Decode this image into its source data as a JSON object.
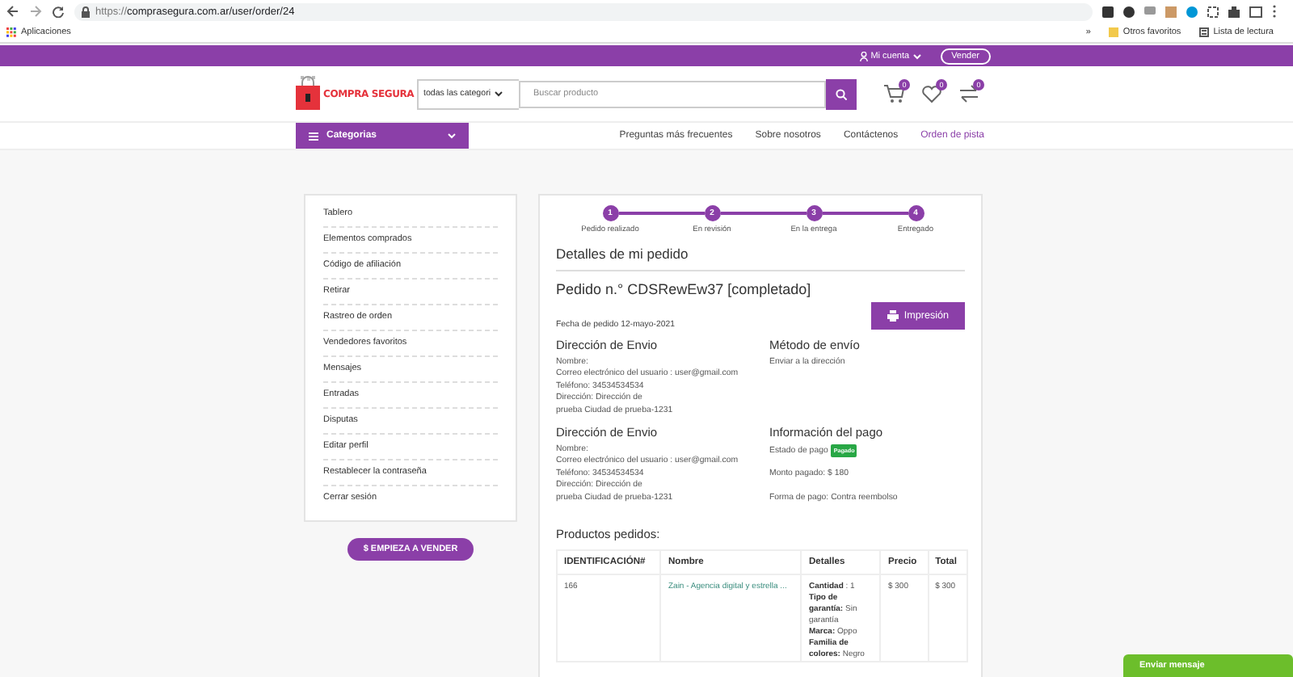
{
  "browser": {
    "url_scheme": "https://",
    "url_rest": "comprasegura.com.ar/user/order/24",
    "bookmarks": [
      {
        "label": "Aplicaciones"
      }
    ],
    "more": "»",
    "right_bookmarks": [
      {
        "kind": "folder",
        "label": "Otros favoritos"
      },
      {
        "kind": "reading",
        "label": "Lista de lectura"
      }
    ]
  },
  "top_bar": {
    "account": "Mi cuenta",
    "sell": "Vender"
  },
  "header": {
    "logo": "COMPRA SEGURA",
    "category_select": "todas las categori",
    "search": {
      "placeholder": "Buscar producto"
    },
    "icons": [
      {
        "kind": "cart",
        "count": "0"
      },
      {
        "kind": "heart",
        "count": "0"
      },
      {
        "kind": "compare",
        "count": "0"
      }
    ]
  },
  "nav": {
    "categories": "Categorias",
    "links": [
      {
        "label": "Preguntas más frecuentes",
        "selected": false
      },
      {
        "label": "Sobre nosotros",
        "selected": false
      },
      {
        "label": "Contáctenos",
        "selected": false
      },
      {
        "label": "Orden de pista",
        "selected": true
      }
    ]
  },
  "sidebar": {
    "items": [
      "Tablero",
      "Elementos comprados",
      "Código de afiliación",
      "Retirar",
      "Rastreo de orden",
      "Vendedores favoritos",
      "Mensajes",
      "Entradas",
      "Disputas",
      "Editar perfil",
      "Restablecer la contraseña",
      "Cerrar sesión"
    ],
    "sell_button": "$ EMPIEZA A VENDER"
  },
  "order": {
    "steps": [
      {
        "number": "1",
        "label": "Pedido realizado",
        "done": true
      },
      {
        "number": "2",
        "label": "En revisión",
        "done": true
      },
      {
        "number": "3",
        "label": "En la entrega",
        "done": true
      },
      {
        "number": "4",
        "label": "Entregado",
        "done": true
      }
    ],
    "title": "Detalles de mi pedido",
    "order_title": "Pedido n.° CDSRewEw37 [completado]",
    "print": "Impresión",
    "date": "Fecha de pedido 12-mayo-2021",
    "sections": [
      {
        "kind": "address",
        "heading": "Dirección de Envio",
        "lines": [
          "Nombre:",
          "Correo electrónico del usuario : user@gmail.com",
          "Teléfono: 34534534534",
          "Dirección: Dirección de",
          "prueba Ciudad de prueba-1231"
        ]
      },
      {
        "kind": "address",
        "heading": "Método de envío",
        "lines": [
          "Enviar a la dirección"
        ]
      },
      {
        "kind": "address",
        "heading": "Dirección de Envio",
        "lines": [
          "Nombre:",
          "Correo electrónico del usuario : user@gmail.com",
          "Teléfono: 34534534534",
          "Dirección: Dirección de",
          "prueba Ciudad de prueba-1231"
        ]
      },
      {
        "kind": "payment",
        "heading": "Información del pago",
        "rows": [
          {
            "text": "Estado de pago",
            "badge": "Pagado"
          },
          {
            "text": "Monto pagado: $ 180"
          },
          {
            "text": "Forma de pago: Contra reembolso"
          }
        ]
      }
    ],
    "products_title": "Productos pedidos:",
    "table": {
      "columns": [
        "IDENTIFICACIÓN#",
        "Nombre",
        "Detalles",
        "Precio",
        "Total"
      ],
      "rows": [
        {
          "id": "166",
          "name": "Zain - Agencia digital y estrella ...",
          "details": [
            "**Cantidad** : 1",
            "**Tipo de garantía:** Sin garantía",
            "**Marca:** Oppo",
            "**Familia de colores:** Negro"
          ],
          "price": "$ 300",
          "total": "$ 300"
        }
      ]
    }
  },
  "chat": {
    "label": "Enviar mensaje"
  }
}
